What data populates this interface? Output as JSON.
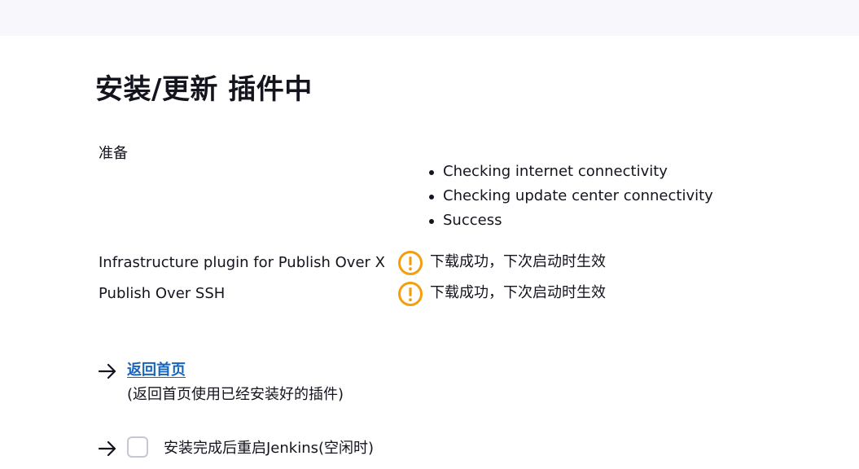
{
  "header": {
    "title": "安装/更新 插件中"
  },
  "preparation": {
    "label": "准备",
    "checks": [
      "Checking internet connectivity",
      "Checking update center connectivity",
      "Success"
    ]
  },
  "plugins": [
    {
      "name": "Infrastructure plugin for Publish Over X",
      "status": "下载成功，下次启动时生效",
      "status_icon": "warning-icon"
    },
    {
      "name": "Publish Over SSH",
      "status": "下载成功，下次启动时生效",
      "status_icon": "warning-icon"
    }
  ],
  "actions": {
    "home_link": "返回首页",
    "home_description": "(返回首页使用已经安装好的插件)",
    "restart_label": "安装完成后重启Jenkins(空闲时)",
    "restart_checked": false
  },
  "colors": {
    "warning": "#f59e0b",
    "link": "#1565c0",
    "topbar": "#f7f7fc"
  }
}
